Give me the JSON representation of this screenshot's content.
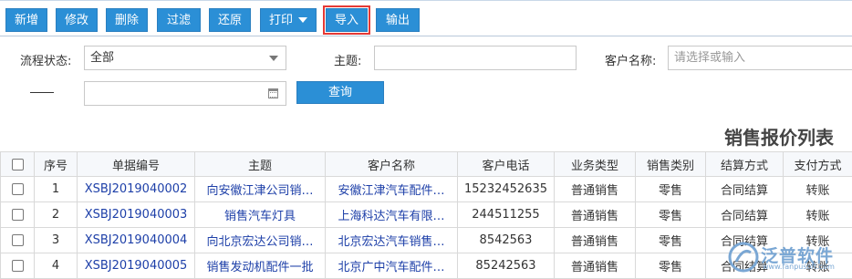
{
  "toolbar": {
    "buttons": [
      {
        "label": "新增"
      },
      {
        "label": "修改"
      },
      {
        "label": "删除"
      },
      {
        "label": "过滤"
      },
      {
        "label": "还原"
      },
      {
        "label": "打印"
      },
      {
        "label": "导入"
      },
      {
        "label": "输出"
      }
    ]
  },
  "filters": {
    "status_label": "流程状态:",
    "status_value": "全部",
    "subject_label": "主题:",
    "subject_value": "",
    "customer_label": "客户名称:",
    "customer_placeholder": "请选择或输入",
    "date_value": "",
    "query_label": "查询"
  },
  "report_title": "销售报价列表",
  "table": {
    "columns": [
      "序号",
      "单据编号",
      "主题",
      "客户名称",
      "客户电话",
      "业务类型",
      "销售类别",
      "结算方式",
      "支付方式"
    ],
    "rows": [
      {
        "no": "1",
        "code": "XSBJ2019040002",
        "subject": "向安徽江津公司销…",
        "customer": "安徽江津汽车配件…",
        "phone": "15232452635",
        "biz": "普通销售",
        "cat": "零售",
        "settle": "合同结算",
        "pay": "转账"
      },
      {
        "no": "2",
        "code": "XSBJ2019040003",
        "subject": "销售汽车灯具",
        "customer": "上海科达汽车有限…",
        "phone": "244511255",
        "biz": "普通销售",
        "cat": "零售",
        "settle": "合同结算",
        "pay": "转账"
      },
      {
        "no": "3",
        "code": "XSBJ2019040004",
        "subject": "向北京宏达公司销…",
        "customer": "北京宏达汽车销售…",
        "phone": "8542563",
        "biz": "普通销售",
        "cat": "零售",
        "settle": "合同结算",
        "pay": "转账"
      },
      {
        "no": "4",
        "code": "XSBJ2019040005",
        "subject": "销售发动机配件一批",
        "customer": "北京广中汽车配件…",
        "phone": "85242563",
        "biz": "普通销售",
        "cat": "零售",
        "settle": "合同结算",
        "pay": "转账"
      }
    ]
  },
  "watermark": {
    "text": "泛普软件",
    "sub": "www.fanpusoft.com"
  },
  "colors": {
    "button_blue": "#2b8fd6",
    "link_blue": "#1d3fa8",
    "highlight_red": "#e53935"
  }
}
